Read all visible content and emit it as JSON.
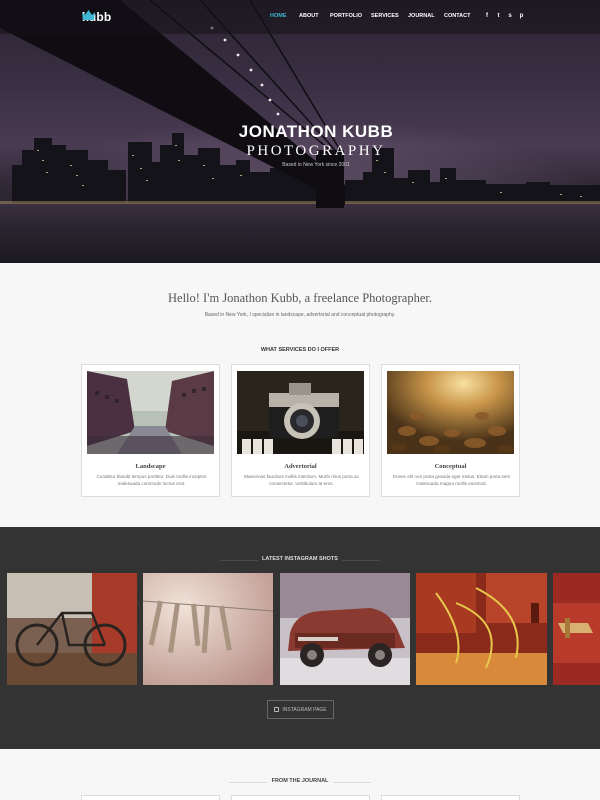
{
  "brand": {
    "name": "kubb",
    "logo_icon": "crown-icon",
    "accent": "#3fb6d4"
  },
  "nav": {
    "items": [
      {
        "label": "HOME",
        "active": true
      },
      {
        "label": "ABOUT",
        "active": false
      },
      {
        "label": "PORTFOLIO",
        "active": false
      },
      {
        "label": "SERVICES",
        "active": false
      },
      {
        "label": "JOURNAL",
        "active": false
      },
      {
        "label": "CONTACT",
        "active": false
      }
    ]
  },
  "social": {
    "icons": [
      {
        "name": "facebook-icon",
        "glyph": "f"
      },
      {
        "name": "twitter-icon",
        "glyph": "t"
      },
      {
        "name": "skype-icon",
        "glyph": "s"
      },
      {
        "name": "pinterest-icon",
        "glyph": "p"
      }
    ]
  },
  "hero": {
    "title": "JONATHON KUBB",
    "subtitle": "PHOTOGRAPHY",
    "tagline": "Based in New York since 2001"
  },
  "intro": {
    "heading": "Hello! I'm Jonathon Kubb, a freelance Photographer.",
    "text": "Based in New York, I specialize in landscape, advertorial and conceptual photography."
  },
  "services": {
    "title": "WHAT SERVICES DO I OFFER",
    "cards": [
      {
        "title": "Landscape",
        "text": "Curabitur blandit tempus porttitor. Duis mollis inceptos malesuada commodo luctus erat."
      },
      {
        "title": "Advertorial",
        "text": "Maecenas faucibus mollis interdum. Morbi risus porta ac consectetur, vestibulum at eros."
      },
      {
        "title": "Conceptual",
        "text": "Donec elit non porta gravida eget metus. Etiam porta sem malesuada magna mollis euismod."
      }
    ]
  },
  "instagram": {
    "title": "LATEST INSTAGRAM SHOTS",
    "button_label": "INSTAGRAM PAGE",
    "button_icon": "instagram-icon"
  },
  "journal": {
    "title": "FROM THE JOURNAL"
  }
}
